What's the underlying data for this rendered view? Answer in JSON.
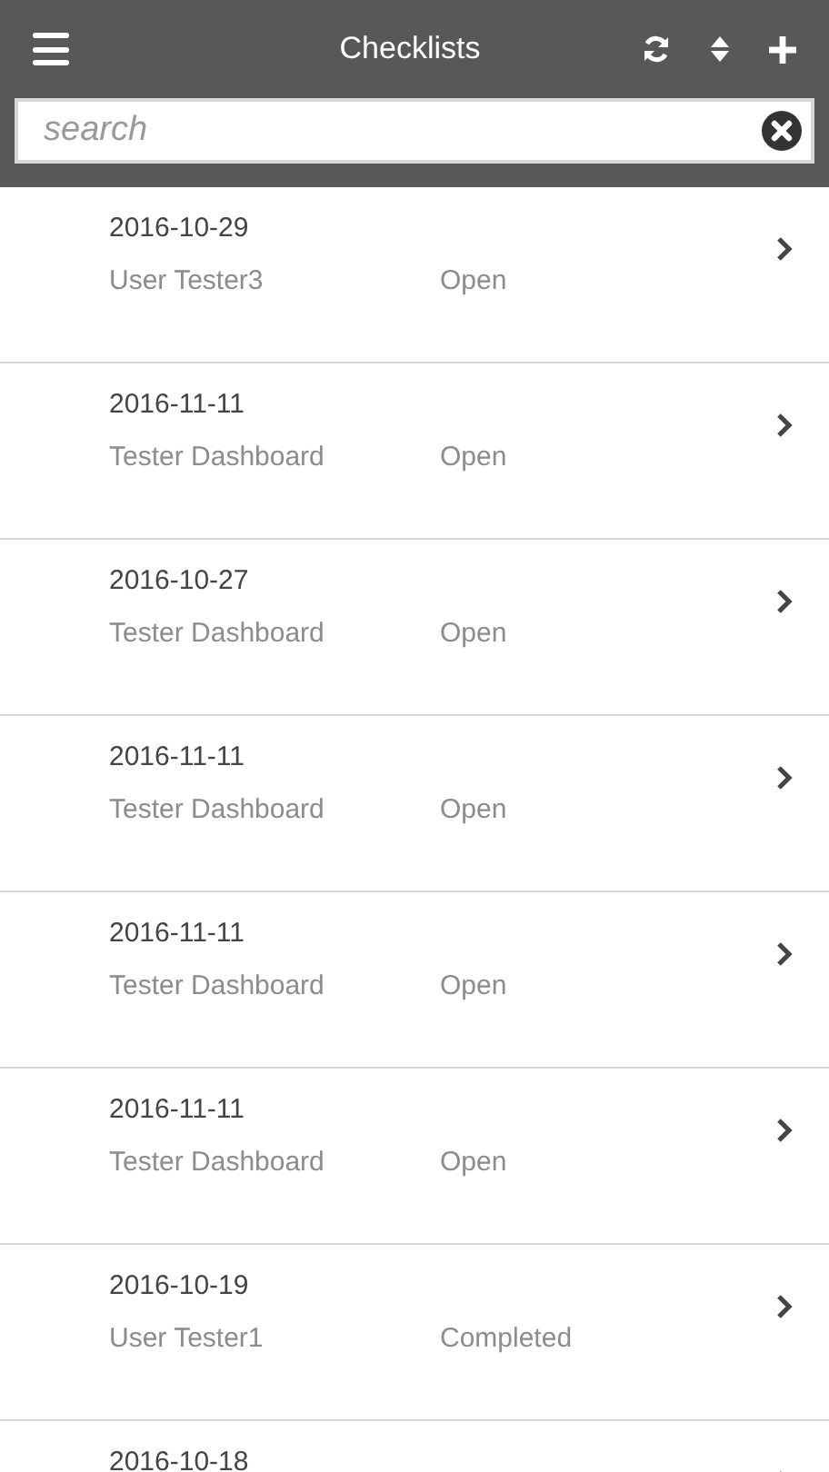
{
  "header": {
    "title": "Checklists"
  },
  "search": {
    "placeholder": "search"
  },
  "rows": [
    {
      "date": "2016-10-29",
      "user": "User Tester3",
      "status": "Open"
    },
    {
      "date": "2016-11-11",
      "user": "Tester Dashboard",
      "status": "Open"
    },
    {
      "date": "2016-10-27",
      "user": "Tester Dashboard",
      "status": "Open"
    },
    {
      "date": "2016-11-11",
      "user": "Tester Dashboard",
      "status": "Open"
    },
    {
      "date": "2016-11-11",
      "user": "Tester Dashboard",
      "status": "Open"
    },
    {
      "date": "2016-11-11",
      "user": "Tester Dashboard",
      "status": "Open"
    },
    {
      "date": "2016-10-19",
      "user": "User Tester1",
      "status": "Completed"
    },
    {
      "date": "2016-10-18"
    }
  ]
}
